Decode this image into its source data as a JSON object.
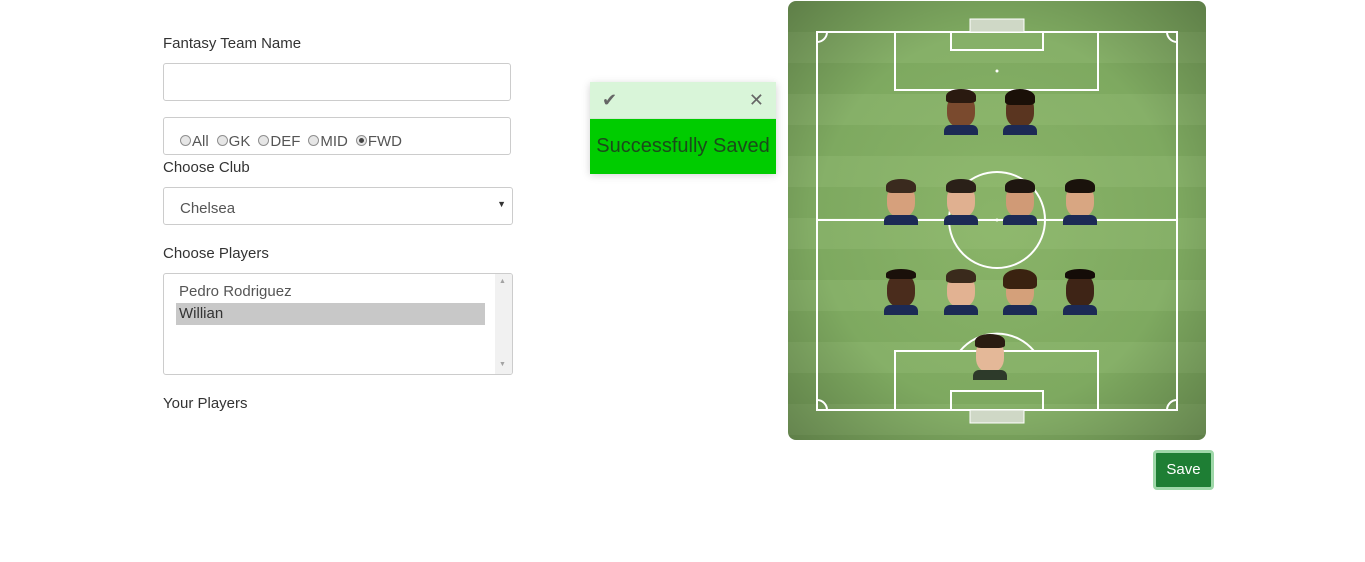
{
  "form": {
    "team_name_label": "Fantasy Team Name",
    "team_name_value": "",
    "positions": [
      {
        "label": "All",
        "checked": false
      },
      {
        "label": "GK",
        "checked": false
      },
      {
        "label": "DEF",
        "checked": false
      },
      {
        "label": "MID",
        "checked": false
      },
      {
        "label": "FWD",
        "checked": true
      }
    ],
    "club_label": "Choose Club",
    "club_value": "Chelsea",
    "players_label": "Choose Players",
    "players_list": [
      {
        "name": "Pedro Rodriguez",
        "selected": false
      },
      {
        "name": "Willian",
        "selected": true
      }
    ],
    "your_players_label": "Your Players"
  },
  "toast": {
    "icon": "check-icon",
    "close_icon": "close-icon",
    "message": "Successfully Saved",
    "color": "#00cc00"
  },
  "pitch": {
    "formation": "4-4-2",
    "players": {
      "forwards": [
        "player",
        "player"
      ],
      "midfielders": [
        "player",
        "player",
        "player",
        "player"
      ],
      "defenders": [
        "player",
        "player",
        "player",
        "player"
      ],
      "goalkeeper": [
        "player"
      ]
    }
  },
  "actions": {
    "save_label": "Save"
  }
}
